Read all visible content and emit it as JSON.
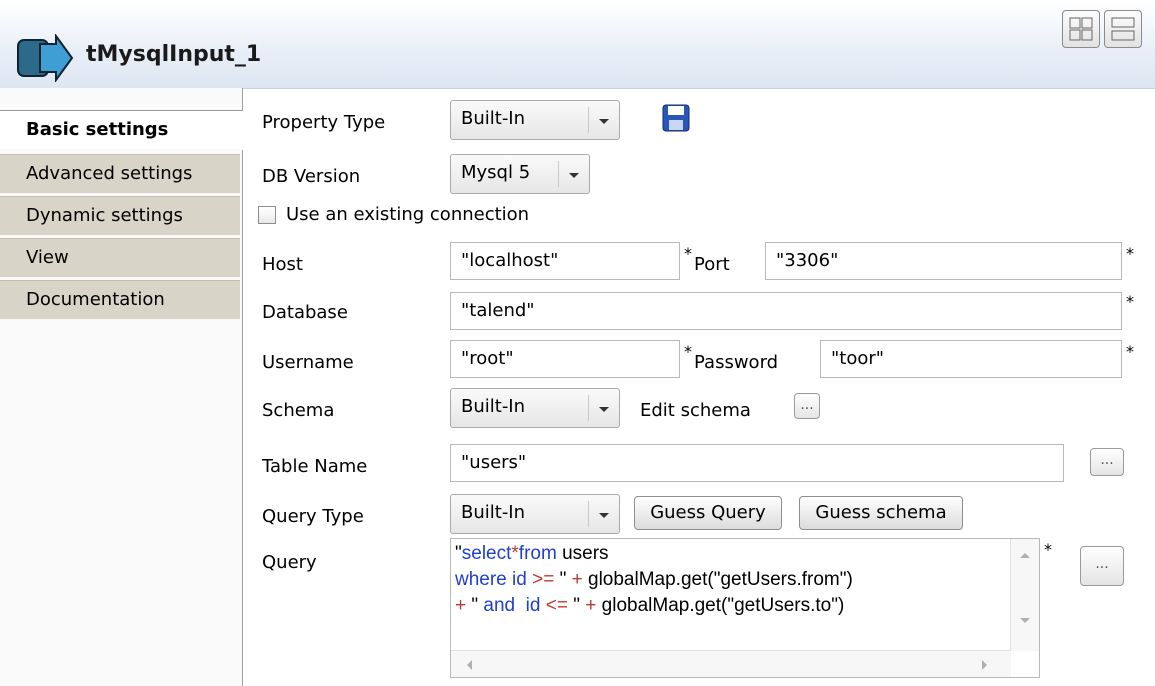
{
  "header": {
    "title": "tMysqlInput_1"
  },
  "tabs": [
    {
      "label": "Basic settings"
    },
    {
      "label": "Advanced settings"
    },
    {
      "label": "Dynamic settings"
    },
    {
      "label": "View"
    },
    {
      "label": "Documentation"
    }
  ],
  "form": {
    "property_type": {
      "label": "Property Type",
      "value": "Built-In"
    },
    "db_version": {
      "label": "DB Version",
      "value": "Mysql 5"
    },
    "use_existing": {
      "label": "Use an existing connection",
      "checked": false
    },
    "host": {
      "label": "Host",
      "value": "\"localhost\""
    },
    "port": {
      "label": "Port",
      "value": "\"3306\""
    },
    "database": {
      "label": "Database",
      "value": "\"talend\""
    },
    "username": {
      "label": "Username",
      "value": "\"root\""
    },
    "password": {
      "label": "Password",
      "value": "\"toor\""
    },
    "schema": {
      "label": "Schema",
      "value": "Built-In",
      "edit_label": "Edit schema"
    },
    "table_name": {
      "label": "Table Name",
      "value": "\"users\""
    },
    "query_type": {
      "label": "Query Type",
      "value": "Built-In",
      "guess_query": "Guess Query",
      "guess_schema": "Guess schema"
    },
    "query": {
      "label": "Query",
      "line1a": "\"",
      "line1b": "select",
      "line1c": "*",
      "line1d": "from",
      "line1e": " users",
      "line2a": "where id",
      "line2b": " >=",
      "line2c": " \" ",
      "line2d": "+",
      "line2e": " globalMap.get(\"getUsers.from\")",
      "line3a": "+",
      "line3b": " \" ",
      "line3c": "and  id",
      "line3d": " <=",
      "line3e": " \" ",
      "line3f": "+",
      "line3g": " globalMap.get(\"getUsers.to\")"
    },
    "required_mark": "*",
    "ellipsis": "..."
  }
}
